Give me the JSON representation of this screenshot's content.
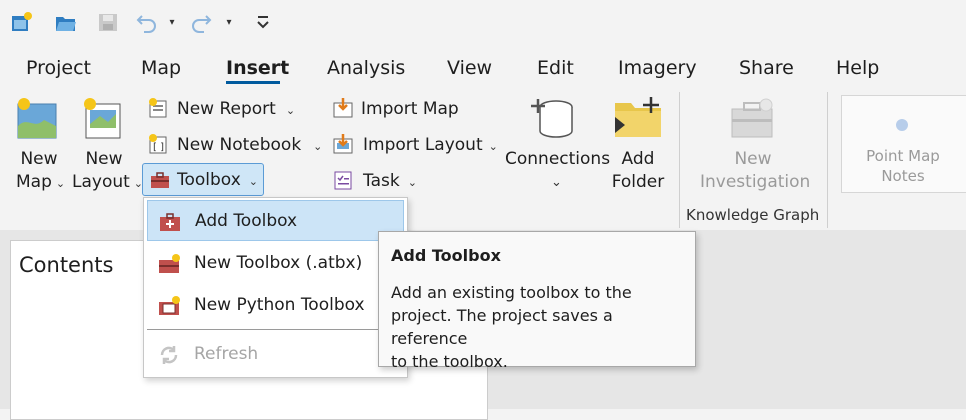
{
  "quick_access": {
    "icons": [
      "new-project-icon",
      "open-project-icon",
      "save-project-icon",
      "undo-icon",
      "redo-icon",
      "customize-qat-icon"
    ]
  },
  "tabs": [
    {
      "label": "Project"
    },
    {
      "label": "Map"
    },
    {
      "label": "Insert",
      "active": true
    },
    {
      "label": "Analysis"
    },
    {
      "label": "View"
    },
    {
      "label": "Edit"
    },
    {
      "label": "Imagery"
    },
    {
      "label": "Share"
    },
    {
      "label": "Help"
    }
  ],
  "ribbon": {
    "new_map": {
      "line1": "New",
      "line2": "Map"
    },
    "new_layout": {
      "line1": "New",
      "line2": "Layout"
    },
    "new_report": "New Report",
    "new_notebook": "New Notebook",
    "toolbox": "Toolbox",
    "import_map": "Import Map",
    "import_layout": "Import Layout",
    "task": "Task",
    "connections": "Connections",
    "add_folder": {
      "line1": "Add",
      "line2": "Folder"
    },
    "new_investigation": {
      "line1": "New",
      "line2": "Investigation"
    },
    "group_knowledge_graph": "Knowledge Graph",
    "point_map_notes": {
      "line1": "Point Map",
      "line2": "Notes"
    }
  },
  "contents_pane": {
    "title": "Contents"
  },
  "toolbox_menu": {
    "items": [
      {
        "label": "Add Toolbox",
        "highlighted": true,
        "enabled": true
      },
      {
        "label": "New Toolbox (.atbx)",
        "enabled": true
      },
      {
        "label": "New Python Toolbox",
        "enabled": true
      },
      {
        "label": "Refresh",
        "enabled": false
      }
    ]
  },
  "tooltip": {
    "title": "Add Toolbox",
    "lines": [
      "Add an existing toolbox to the",
      "project. The project saves a reference",
      "to the toolbox."
    ]
  },
  "colors": {
    "accent": "#005a9e",
    "toolbox_red": "#c0504d",
    "folder_yellow": "#e8c64a"
  }
}
